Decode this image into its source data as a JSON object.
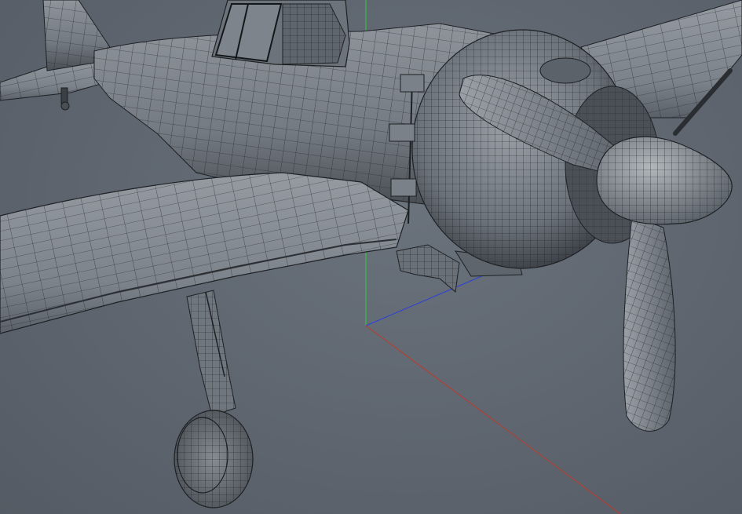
{
  "viewport": {
    "background": "#5f6670",
    "mesh_color": "#1e2124",
    "surface_light": "#8e949a",
    "surface_mid": "#6f757c",
    "surface_dark": "#3c4147"
  },
  "axes": {
    "x_axis_color": "#c0392b",
    "y_axis_color": "#2ecc40",
    "z_axis_color": "#2b3fd8"
  },
  "scene": {
    "object": "aircraft-wireframe-model",
    "parts": [
      "fuselage",
      "canopy",
      "tail-stabilizer",
      "left-wing",
      "right-wing",
      "engine-cowling",
      "propeller-spinner",
      "propeller-blade-upper",
      "propeller-blade-lower",
      "main-landing-gear",
      "landing-gear-wheel",
      "tail-wheel"
    ]
  }
}
